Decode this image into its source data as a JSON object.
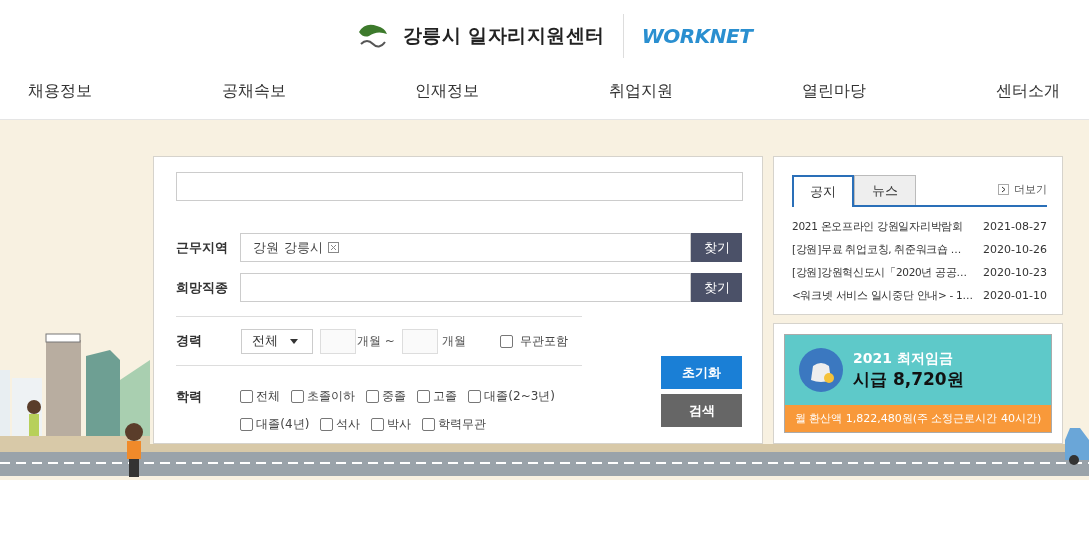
{
  "header": {
    "center_name": "강릉시 일자리지원센터",
    "partner_logo": "WORKNET"
  },
  "nav": [
    "채용정보",
    "공채속보",
    "인재정보",
    "취업지원",
    "열린마당",
    "센터소개"
  ],
  "fields": [
    {
      "label": "근무지역",
      "tag": "강원 강릉시",
      "button": "찾기"
    },
    {
      "label": "희망직종",
      "button": "찾기"
    }
  ],
  "career": {
    "label": "경력",
    "select": "전체",
    "unit_from": "개월 ~",
    "unit_to": "개월",
    "option": {
      "label": "무관포함",
      "checked": false
    }
  },
  "education": {
    "label": "학력",
    "options": [
      {
        "label": "전체",
        "checked": false
      },
      {
        "label": "초졸이하",
        "checked": false
      },
      {
        "label": "중졸",
        "checked": false
      },
      {
        "label": "고졸",
        "checked": false
      },
      {
        "label": "대졸(2~3년)",
        "checked": false
      },
      {
        "label": "대졸(4년)",
        "checked": false
      },
      {
        "label": "석사",
        "checked": false
      },
      {
        "label": "박사",
        "checked": false
      },
      {
        "label": "학력무관",
        "checked": false
      }
    ]
  },
  "buttons": [
    {
      "label": "초기화",
      "kind": "primary"
    },
    {
      "label": "검색",
      "kind": "secondary"
    }
  ],
  "news": {
    "tabs": [
      {
        "label": "공지",
        "selected": true
      },
      {
        "label": "뉴스",
        "selected": false
      }
    ],
    "more": "더보기",
    "items": [
      {
        "title": "2021 온오프라인 강원일자리박람회",
        "date": "2021-08-27"
      },
      {
        "title": "[강원]무료 취업코칭, 취준워크숍 …",
        "date": "2020-10-26"
      },
      {
        "title": "[강원]강원혁신도시「2020년 공공…",
        "date": "2020-10-23"
      },
      {
        "title": "<워크넷 서비스 일시중단 안내> - 1…",
        "date": "2020-01-10"
      }
    ]
  },
  "banner": {
    "title": "2021 최저임금",
    "wage": "시급 8,720원",
    "note": "월 환산액 1,822,480원(주 소정근로시간 40시간)"
  }
}
